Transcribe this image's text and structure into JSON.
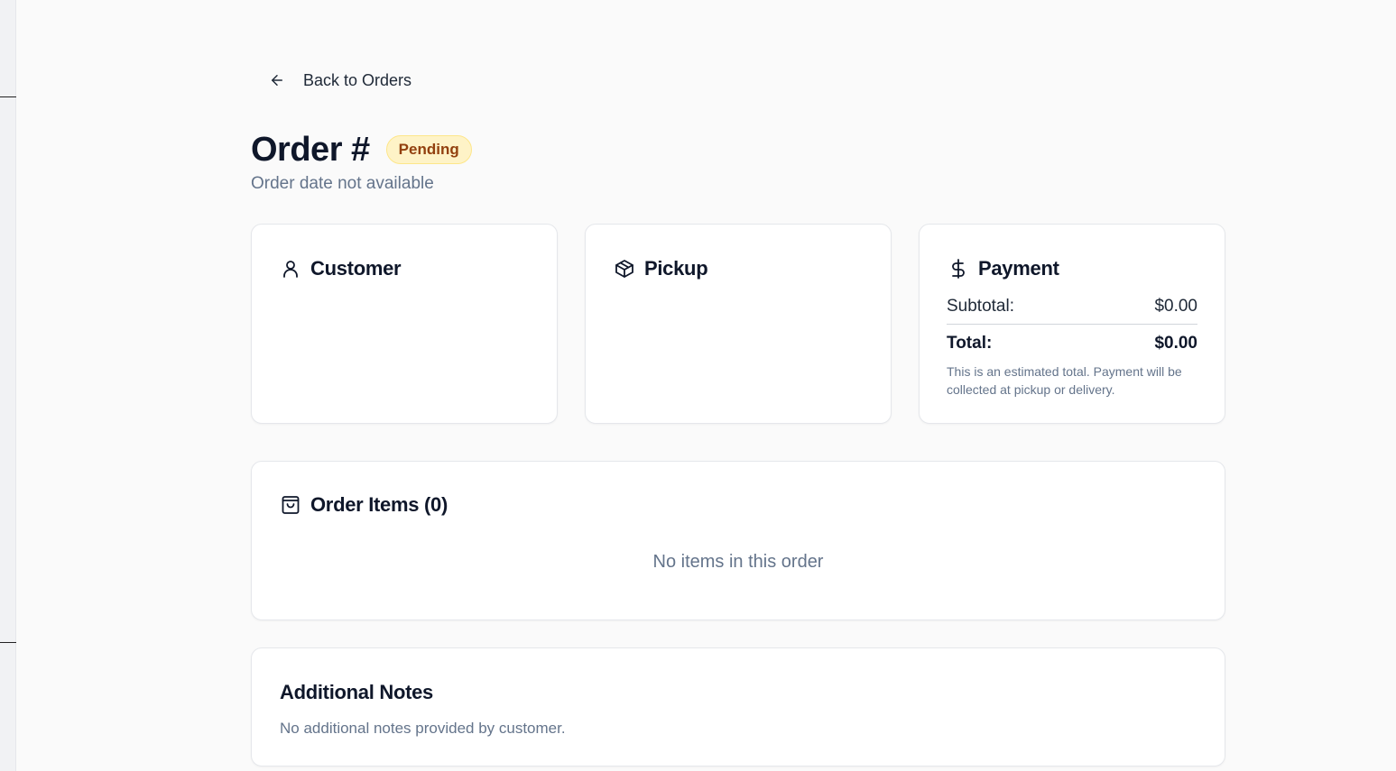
{
  "nav": {
    "back_label": "Back to Orders",
    "back_icon": "arrow-left-icon"
  },
  "header": {
    "title": "Order #",
    "status": "Pending",
    "order_date": "Order date not available"
  },
  "customer": {
    "title": "Customer",
    "icon": "user-icon"
  },
  "pickup": {
    "title": "Pickup",
    "icon": "package-icon"
  },
  "payment": {
    "title": "Payment",
    "icon": "dollar-icon",
    "subtotal_label": "Subtotal:",
    "subtotal_value": "$0.00",
    "total_label": "Total:",
    "total_value": "$0.00",
    "note": "This is an estimated total. Payment will be collected at pickup or delivery."
  },
  "items": {
    "title": "Order Items (0)",
    "icon": "shopping-bag-icon",
    "empty_text": "No items in this order"
  },
  "notes": {
    "title": "Additional Notes",
    "text": "No additional notes provided by customer."
  },
  "colors": {
    "background": "#fafafa",
    "status_badge_bg": "#fef3c7",
    "status_badge_text": "#92400e",
    "muted_text": "#64748b"
  }
}
